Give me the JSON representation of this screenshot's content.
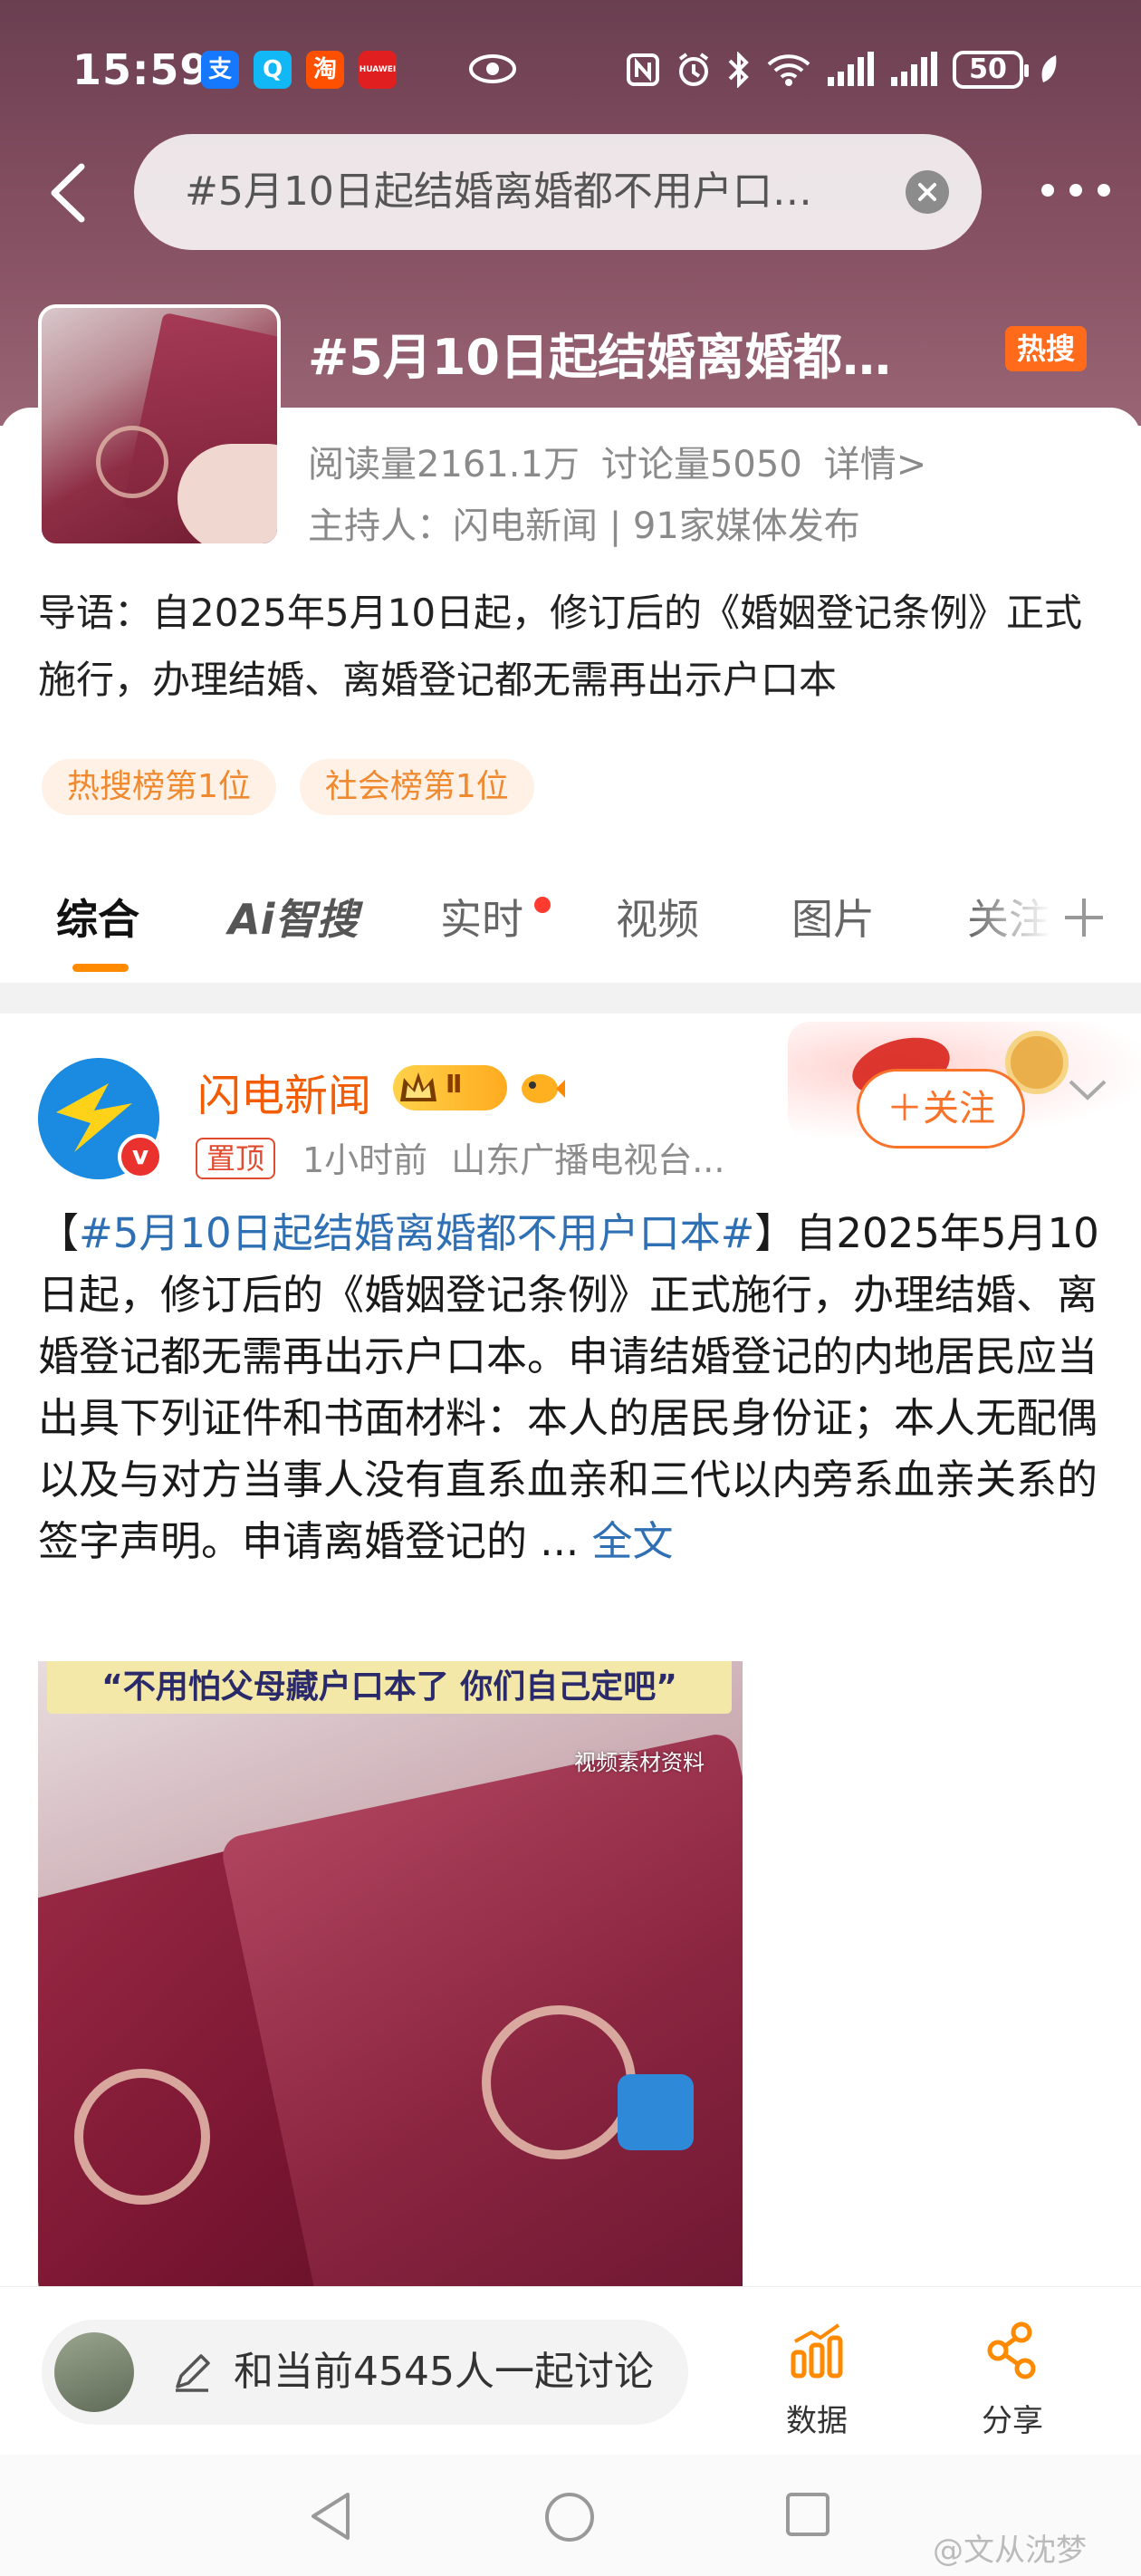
{
  "status_bar": {
    "time": "15:59",
    "apps": [
      {
        "icon": "alipay-icon",
        "glyph": "支",
        "color": "#1677ff"
      },
      {
        "icon": "qq-icon",
        "glyph": "Q",
        "color": "#12b7f5"
      },
      {
        "icon": "taobao-icon",
        "glyph": "淘",
        "color": "#ff5000"
      },
      {
        "icon": "huawei-icon",
        "glyph": "HUAWEI",
        "color": "#e02020"
      }
    ],
    "battery": "50"
  },
  "search": {
    "query": "#5月10日起结婚离婚都不用户口…"
  },
  "topic": {
    "title": "#5月10日起结婚离婚都…",
    "hot_badge": "热搜",
    "reads": "阅读量2161.1万",
    "discussions": "讨论量5050",
    "details": "详情>",
    "host": "主持人：闪电新闻 | 91家媒体发布",
    "lead": "导语：自2025年5月10日起，修订后的《婚姻登记条例》正式施行，办理结婚、离婚登记都无需再出示户口本",
    "rank_tags": [
      "热搜榜第1位",
      "社会榜第1位"
    ]
  },
  "tabs": {
    "items": [
      "综合",
      "Ai智搜",
      "实时",
      "视频",
      "图片",
      "关注"
    ],
    "active": "综合"
  },
  "post": {
    "author": "闪电新闻",
    "level": "Ⅱ",
    "pinned": "置顶",
    "time": "1小时前",
    "source": "山东广播电视台...",
    "follow_label": "＋关注",
    "body_prefix": "【",
    "hashtag": "#5月10日起结婚离婚都不用户口本#",
    "body_main": "】自2025年5月10日起，修订后的《婚姻登记条例》正式施行，办理结婚、离婚登记都无需再出示户口本。申请结婚登记的内地居民应当出具下列证件和书面材料：本人的居民身份证；本人无配偶以及与对方当事人没有直系血亲和三代以内旁系血亲关系的签字声明。申请离婚登记的 ... ",
    "full_text": "全文",
    "video": {
      "caption": "“不用怕父母藏户口本了 你们自己定吧”",
      "watermark": "视频素材资料"
    }
  },
  "action_bar": {
    "input_placeholder": "和当前4545人一起讨论",
    "data_label": "数据",
    "share_label": "分享"
  },
  "watermark": "@文从沈梦",
  "colors": {
    "accent_orange": "#ff8a00",
    "link_blue": "#2f6fb3",
    "author_orange": "#f25c05"
  }
}
